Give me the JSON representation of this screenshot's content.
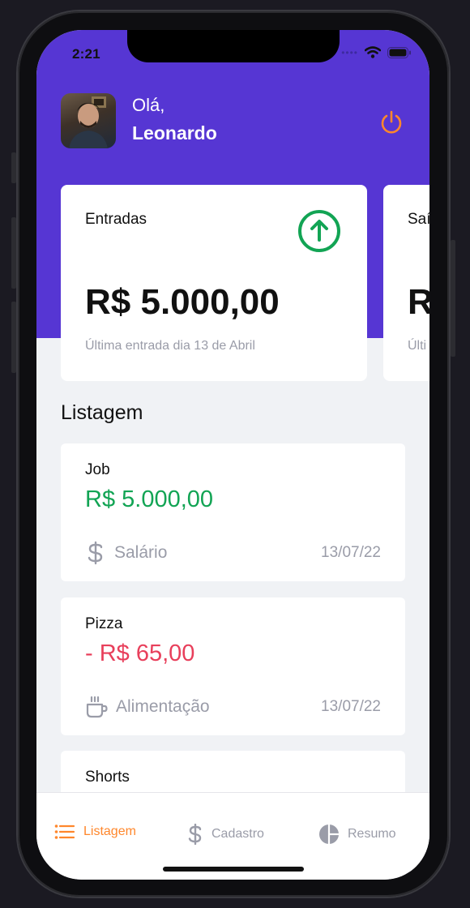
{
  "status_bar": {
    "time": "2:21"
  },
  "header": {
    "greeting": "Olá,",
    "user_name": "Leonardo",
    "logout_icon": "power-icon"
  },
  "cards": [
    {
      "title": "Entradas",
      "amount": "R$ 5.000,00",
      "subtitle": "Última entrada dia 13 de Abril",
      "icon": "arrow-up-circle-icon",
      "icon_color": "#12a454"
    },
    {
      "title": "Saídas",
      "amount": "R",
      "subtitle": "Últi"
    }
  ],
  "listing": {
    "title": "Listagem",
    "items": [
      {
        "title": "Job",
        "amount": "R$ 5.000,00",
        "type": "income",
        "category": "Salário",
        "category_icon": "dollar-icon",
        "date": "13/07/22"
      },
      {
        "title": "Pizza",
        "amount": "- R$ 65,00",
        "type": "outcome",
        "category": "Alimentação",
        "category_icon": "coffee-icon",
        "date": "13/07/22"
      },
      {
        "title": "Shorts"
      }
    ]
  },
  "tabs": [
    {
      "label": "Listagem",
      "icon": "list-icon",
      "active": true
    },
    {
      "label": "Cadastro",
      "icon": "dollar-icon",
      "active": false
    },
    {
      "label": "Resumo",
      "icon": "pie-chart-icon",
      "active": false
    }
  ],
  "colors": {
    "primary": "#5636d3",
    "income": "#12a454",
    "outcome": "#e83f5b",
    "accent": "#ff872c",
    "muted": "#9a9ca8",
    "background": "#f0f2f5"
  }
}
